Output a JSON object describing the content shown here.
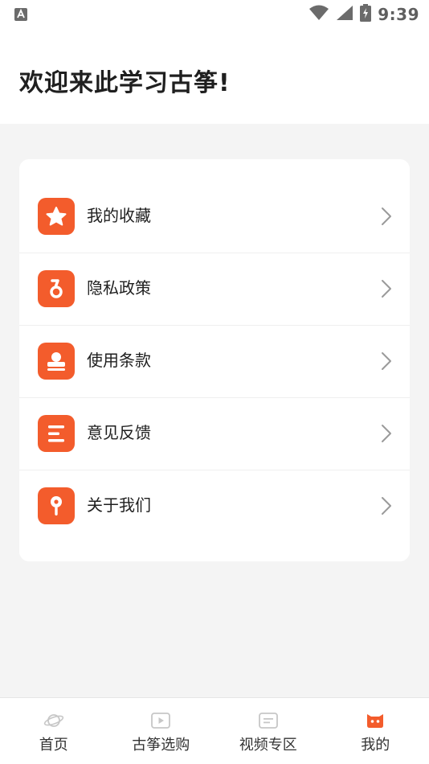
{
  "status_bar": {
    "time": "9:39",
    "left_icon": "keyboard-a-icon",
    "right_icons": [
      "wifi-icon",
      "signal-icon",
      "battery-charging-icon"
    ]
  },
  "header": {
    "title": "欢迎来此学习古筝!"
  },
  "menu": {
    "items": [
      {
        "label": "我的收藏",
        "icon": "star-icon"
      },
      {
        "label": "隐私政策",
        "icon": "privacy-icon"
      },
      {
        "label": "使用条款",
        "icon": "stamp-icon"
      },
      {
        "label": "意见反馈",
        "icon": "feedback-list-icon"
      },
      {
        "label": "关于我们",
        "icon": "location-pin-icon"
      }
    ]
  },
  "bottom_nav": {
    "items": [
      {
        "label": "首页",
        "icon": "planet-icon",
        "active": false
      },
      {
        "label": "古筝选购",
        "icon": "play-video-icon",
        "active": false
      },
      {
        "label": "视频专区",
        "icon": "message-icon",
        "active": false
      },
      {
        "label": "我的",
        "icon": "cat-face-icon",
        "active": true
      }
    ]
  },
  "colors": {
    "accent": "#f35c2c",
    "background": "#f4f4f4",
    "card": "#ffffff",
    "text": "#1f1f1f",
    "inactive_icon": "#c7c7c7"
  }
}
